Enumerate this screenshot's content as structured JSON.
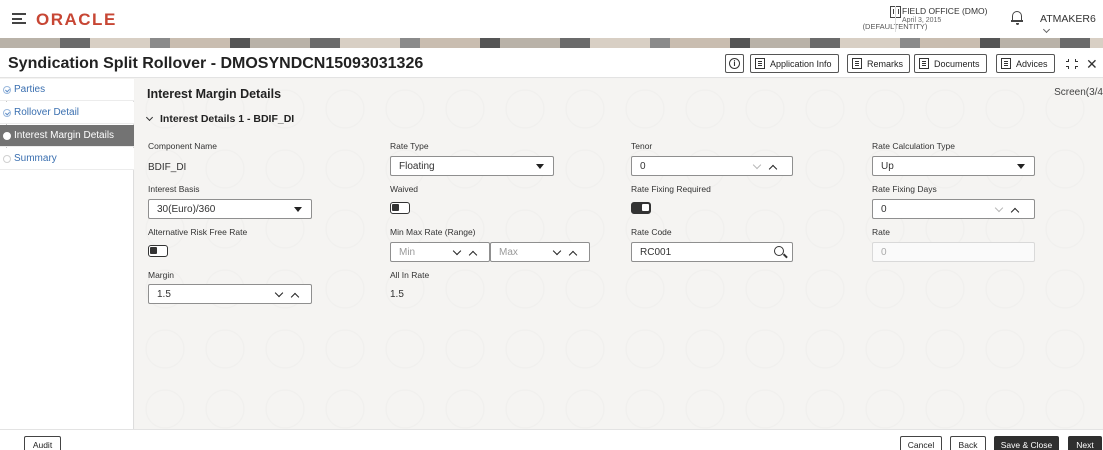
{
  "header": {
    "logo": "ORACLE",
    "entity": "(DEFAULTENTITY)",
    "office": "FIELD OFFICE (DMO)",
    "date": "April 3, 2015",
    "user": "ATMAKER6"
  },
  "title_bar": {
    "title": "Syndication Split Rollover - DMOSYNDCN15093031326",
    "buttons": {
      "info": "i",
      "application_info": "Application Info",
      "remarks": "Remarks",
      "documents": "Documents",
      "advices": "Advices"
    }
  },
  "sidebar": {
    "items": [
      {
        "label": "Parties",
        "state": "done"
      },
      {
        "label": "Rollover Detail",
        "state": "done"
      },
      {
        "label": "Interest Margin Details",
        "state": "current"
      },
      {
        "label": "Summary",
        "state": "pending"
      }
    ]
  },
  "main": {
    "section_title": "Interest Margin Details",
    "screen_indicator": "Screen(3/4",
    "accordion": "Interest Details 1 - BDIF_DI",
    "fields": {
      "component_name": {
        "label": "Component Name",
        "value": "BDIF_DI"
      },
      "rate_type": {
        "label": "Rate Type",
        "value": "Floating"
      },
      "tenor": {
        "label": "Tenor",
        "value": "0"
      },
      "rate_calculation_type": {
        "label": "Rate Calculation Type",
        "value": "Up"
      },
      "interest_basis": {
        "label": "Interest Basis",
        "value": "30(Euro)/360"
      },
      "waived": {
        "label": "Waived",
        "on": false
      },
      "rate_fixing_required": {
        "label": "Rate Fixing Required",
        "on": true
      },
      "rate_fixing_days": {
        "label": "Rate Fixing Days",
        "value": "0"
      },
      "alternative_risk_free_rate": {
        "label": "Alternative Risk Free Rate",
        "on": false
      },
      "min_max_rate": {
        "label": "Min Max Rate (Range)",
        "min_placeholder": "Min",
        "max_placeholder": "Max"
      },
      "rate_code": {
        "label": "Rate Code",
        "value": "RC001"
      },
      "rate": {
        "label": "Rate",
        "value": "0"
      },
      "margin": {
        "label": "Margin",
        "value": "1.5"
      },
      "all_in_rate": {
        "label": "All In Rate",
        "value": "1.5"
      }
    }
  },
  "footer": {
    "audit": "Audit",
    "cancel": "Cancel",
    "back": "Back",
    "save_close": "Save & Close",
    "next": "Next"
  },
  "colors": {
    "brand": "#c74634",
    "sidebar_link": "#3a6fb0",
    "sidebar_active": "#737373",
    "primary_button": "#2f2f2f"
  }
}
